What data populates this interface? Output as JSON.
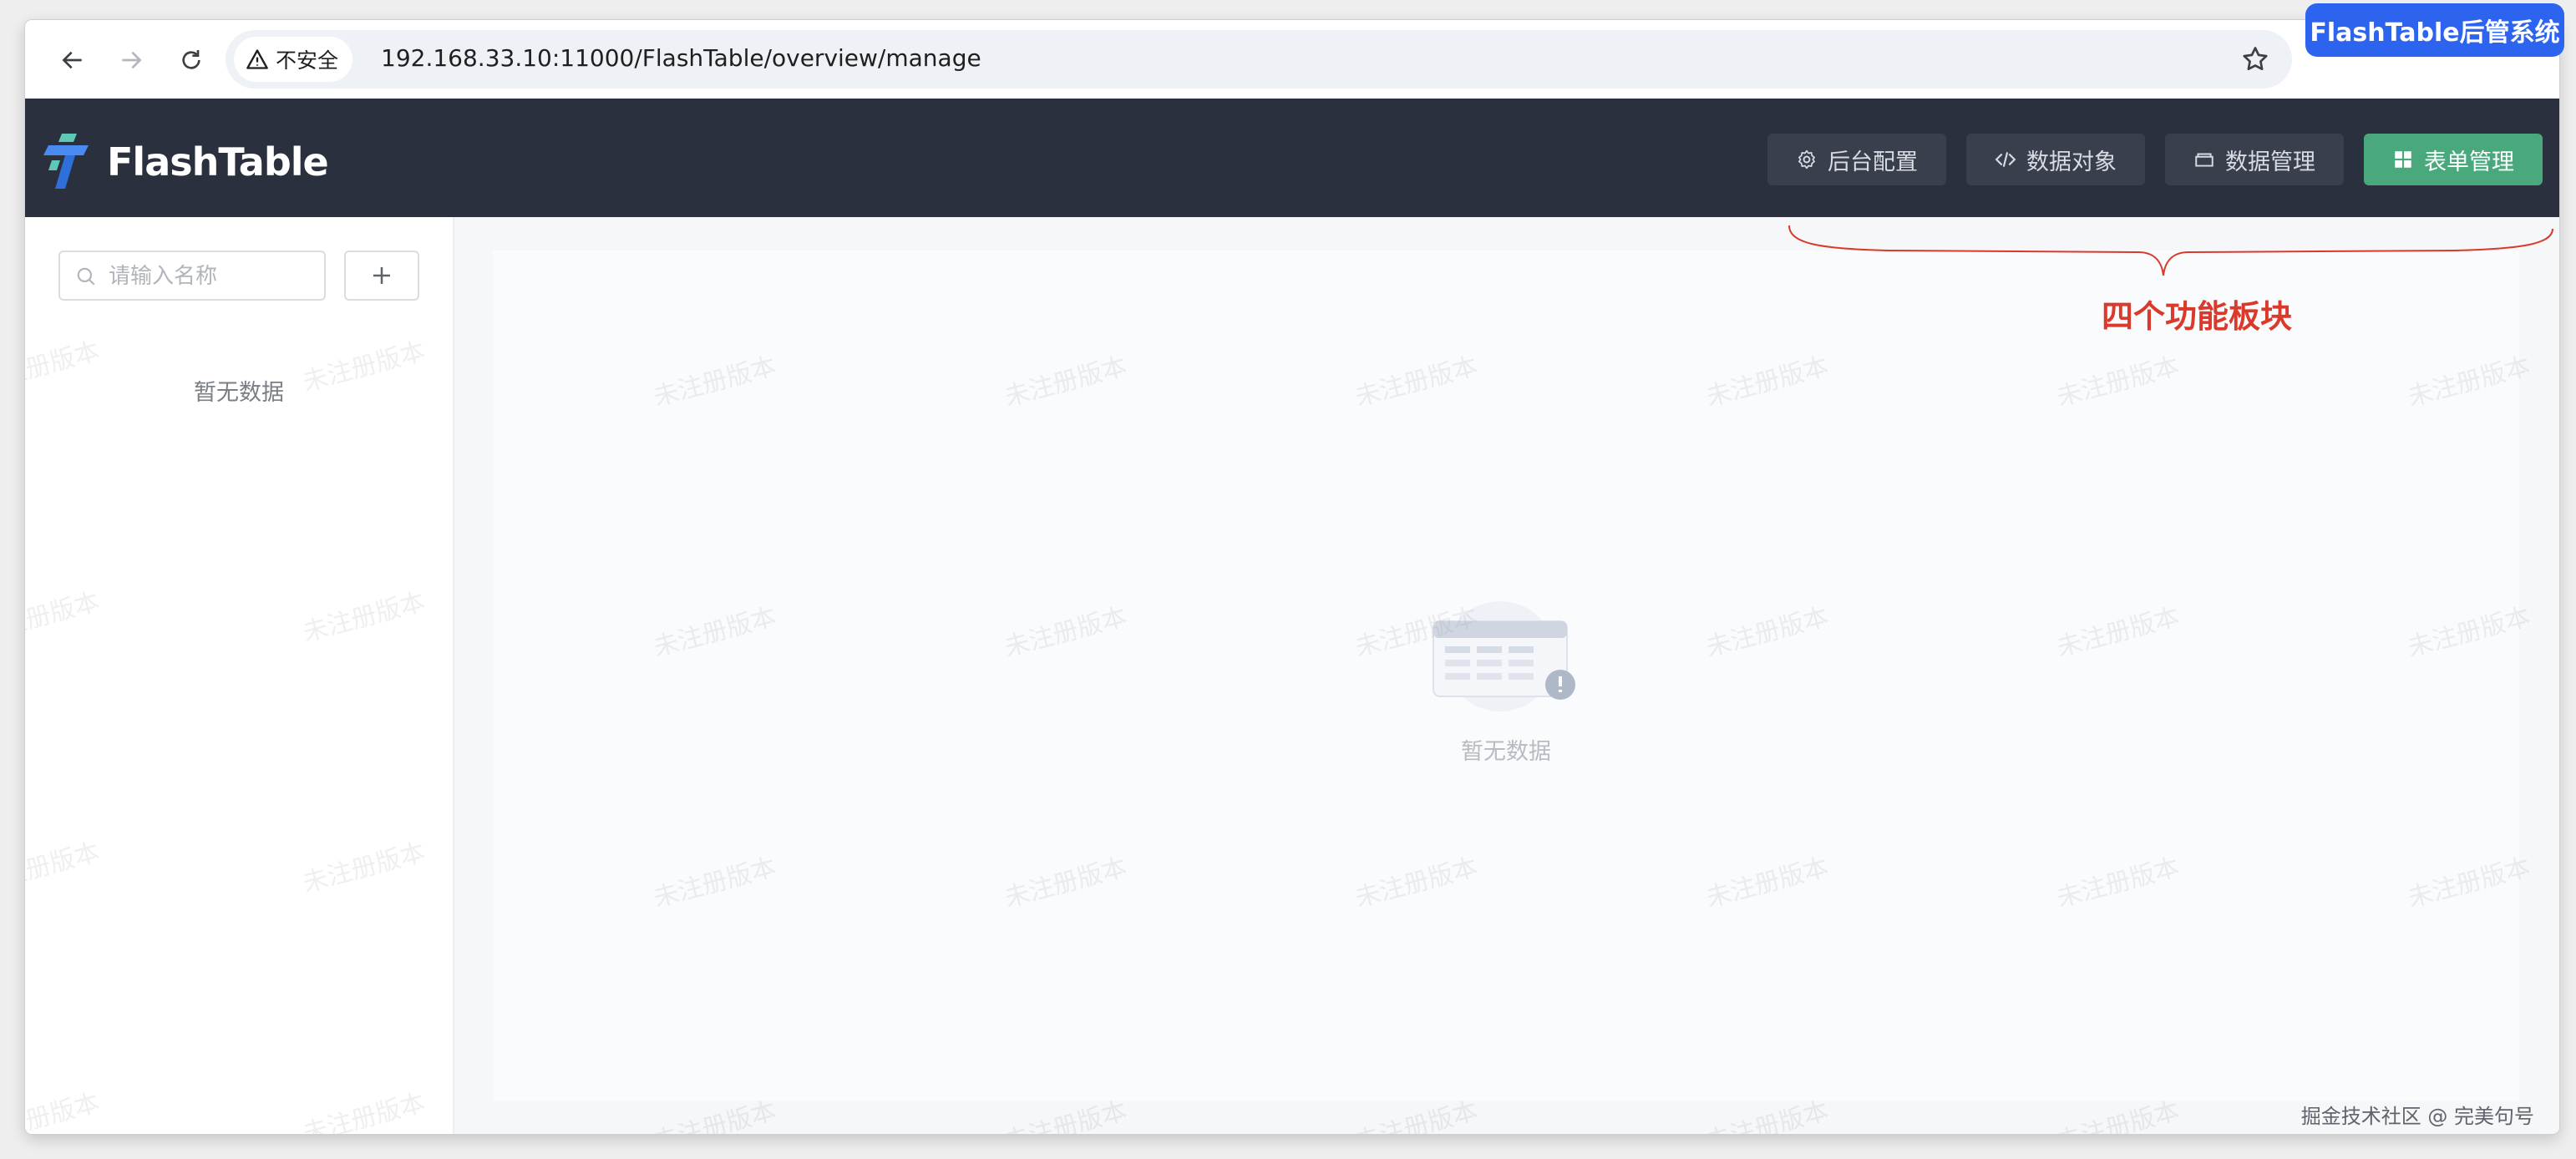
{
  "browser": {
    "security_label": "不安全",
    "url": "192.168.33.10:11000/FlashTable/overview/manage"
  },
  "overlay_badge": "FlashTable后管系统",
  "header": {
    "logo_text": "FlashTable",
    "buttons": [
      {
        "label": "后台配置",
        "icon": "gear-icon",
        "active": false
      },
      {
        "label": "数据对象",
        "icon": "code-icon",
        "active": false
      },
      {
        "label": "数据管理",
        "icon": "database-icon",
        "active": false
      },
      {
        "label": "表单管理",
        "icon": "grid-icon",
        "active": true
      }
    ]
  },
  "sidebar": {
    "search_placeholder": "请输入名称",
    "empty_text": "暂无数据"
  },
  "main": {
    "empty_text": "暂无数据"
  },
  "annotation": {
    "text": "四个功能板块"
  },
  "watermark_text": "未注册版本",
  "credit": "掘金技术社区 @ 完美句号",
  "colors": {
    "header_bg": "#2b303f",
    "active_button": "#4aa97c",
    "annotation": "#d93a2b",
    "badge": "#2c64f0"
  }
}
